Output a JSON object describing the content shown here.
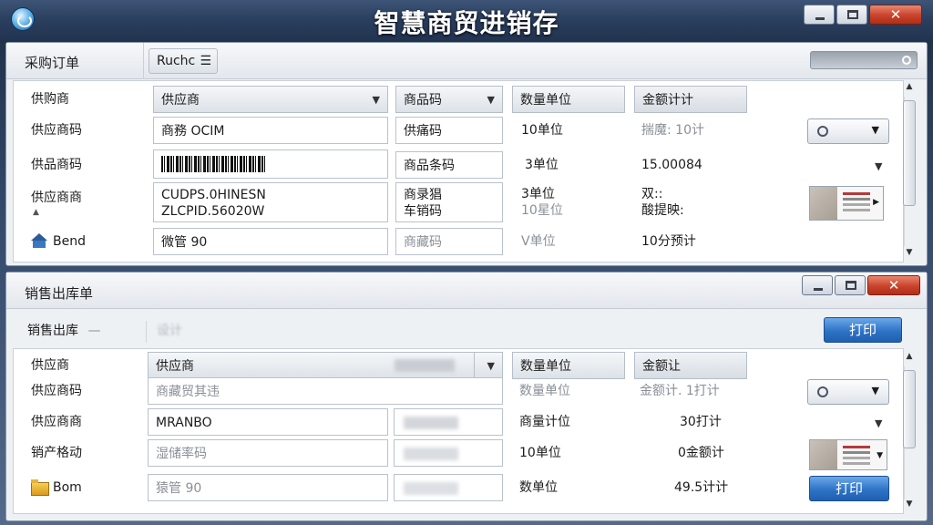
{
  "app": {
    "title": "智慧商贸进销存",
    "close_glyph": "✕"
  },
  "purchase": {
    "title": "采购订单",
    "toolbar_btn": "Ruchc",
    "toolbar_btn_icon": "☰",
    "header": {
      "label": "供购商",
      "select": "供应商",
      "col3": "商品码",
      "col4": "数量单位",
      "col5": "金额计计"
    },
    "rows": [
      {
        "label": "供应商码",
        "field": "商務 OCIM",
        "col3": "供痛码",
        "col4": "10单位",
        "col5": "揣魔: 10计"
      },
      {
        "label": "供品商码",
        "col3": "商品条码",
        "col4": "3单位",
        "col5": "15.00084"
      },
      {
        "label": "供应商商",
        "field_l1": "CUDPS.0HINESN",
        "field_l2": "ZLCPID.56020W",
        "col3_l1": "商录猖",
        "col3_l2": "车销码",
        "col4_l1": "3单位",
        "col4_l2": "10星位",
        "col5_l1": "双::",
        "col5_l2": "酸提映:"
      },
      {
        "label": "Bend",
        "field": "微管 90",
        "col3": "商藏码",
        "col4": "V单位",
        "col5": "10分预计"
      }
    ]
  },
  "sales": {
    "title": "销售出库单",
    "subtitle": "销售出库",
    "subtitle_dash": "—",
    "toolbar_dim": "设计",
    "print_label": "打印",
    "header": {
      "label": "供应商",
      "select": "供应商",
      "col4": "数量单位",
      "col5": "金额让"
    },
    "rows": [
      {
        "label": "供应商码",
        "field": "商藏贸其违",
        "col4": "数量单位",
        "col5": "金额计. 1打计"
      },
      {
        "label": "供应商商",
        "field": "MRANBO",
        "col4": "商量计位",
        "col5": "30打计"
      },
      {
        "label": "销产格动",
        "field": "湿储率码",
        "col4": "10单位",
        "col5": "0金额计"
      },
      {
        "label": "Bom",
        "field": "猿管 90",
        "col4": "数单位",
        "col5": "49.5计计",
        "print_label": "打印"
      }
    ]
  },
  "colors": {
    "print_blue": "#2f73c6",
    "close_red": "#c8432b",
    "title_bar": "#2a3e5e"
  }
}
